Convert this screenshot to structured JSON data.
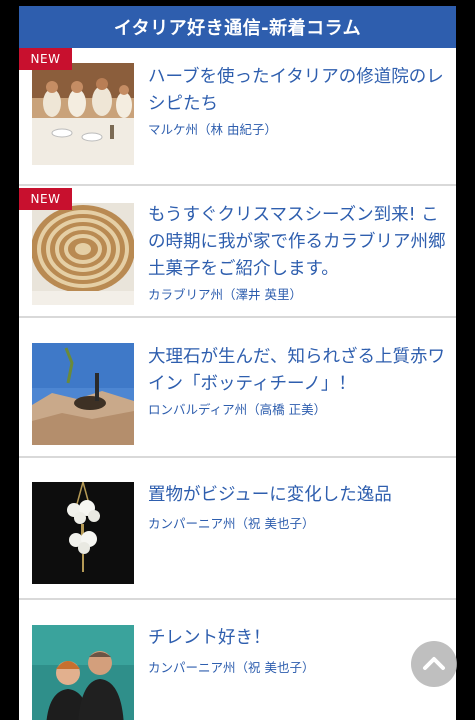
{
  "header": {
    "title": "イタリア好き通信-新着コラム"
  },
  "items": [
    {
      "badge": "NEW",
      "title": "ハーブを使ったイタリアの修道院のレシピたち",
      "author": "マルケ州（林 由紀子）",
      "thumb": "monastery-kitchen-photo"
    },
    {
      "badge": "NEW",
      "title": "もうすぐクリスマスシーズン到来! この時期に我が家で作るカラブリア州郷土菓子をご紹介します。",
      "author": "カラブリア州（澤井 英里）",
      "thumb": "spiral-pastry-photo"
    },
    {
      "badge": "",
      "title": "大理石が生んだ、知られざる上質赤ワイン「ボッティチーノ」！",
      "author": "ロンバルディア州（高橋 正美）",
      "thumb": "marble-quarry-photo"
    },
    {
      "badge": "",
      "title": "置物がビジューに変化した逸品",
      "author": "カンパーニア州（祝 美也子）",
      "thumb": "bijou-necklace-photo"
    },
    {
      "badge": "",
      "title": "チレント好き！",
      "author": "カンパーニア州（祝 美也子）",
      "thumb": "couple-portrait-photo"
    }
  ],
  "scroll_top": {
    "icon": "chevron-up-icon"
  },
  "colors": {
    "brand": "#2e5eae",
    "badge": "#c8102e",
    "divider": "#d9d9d9"
  }
}
